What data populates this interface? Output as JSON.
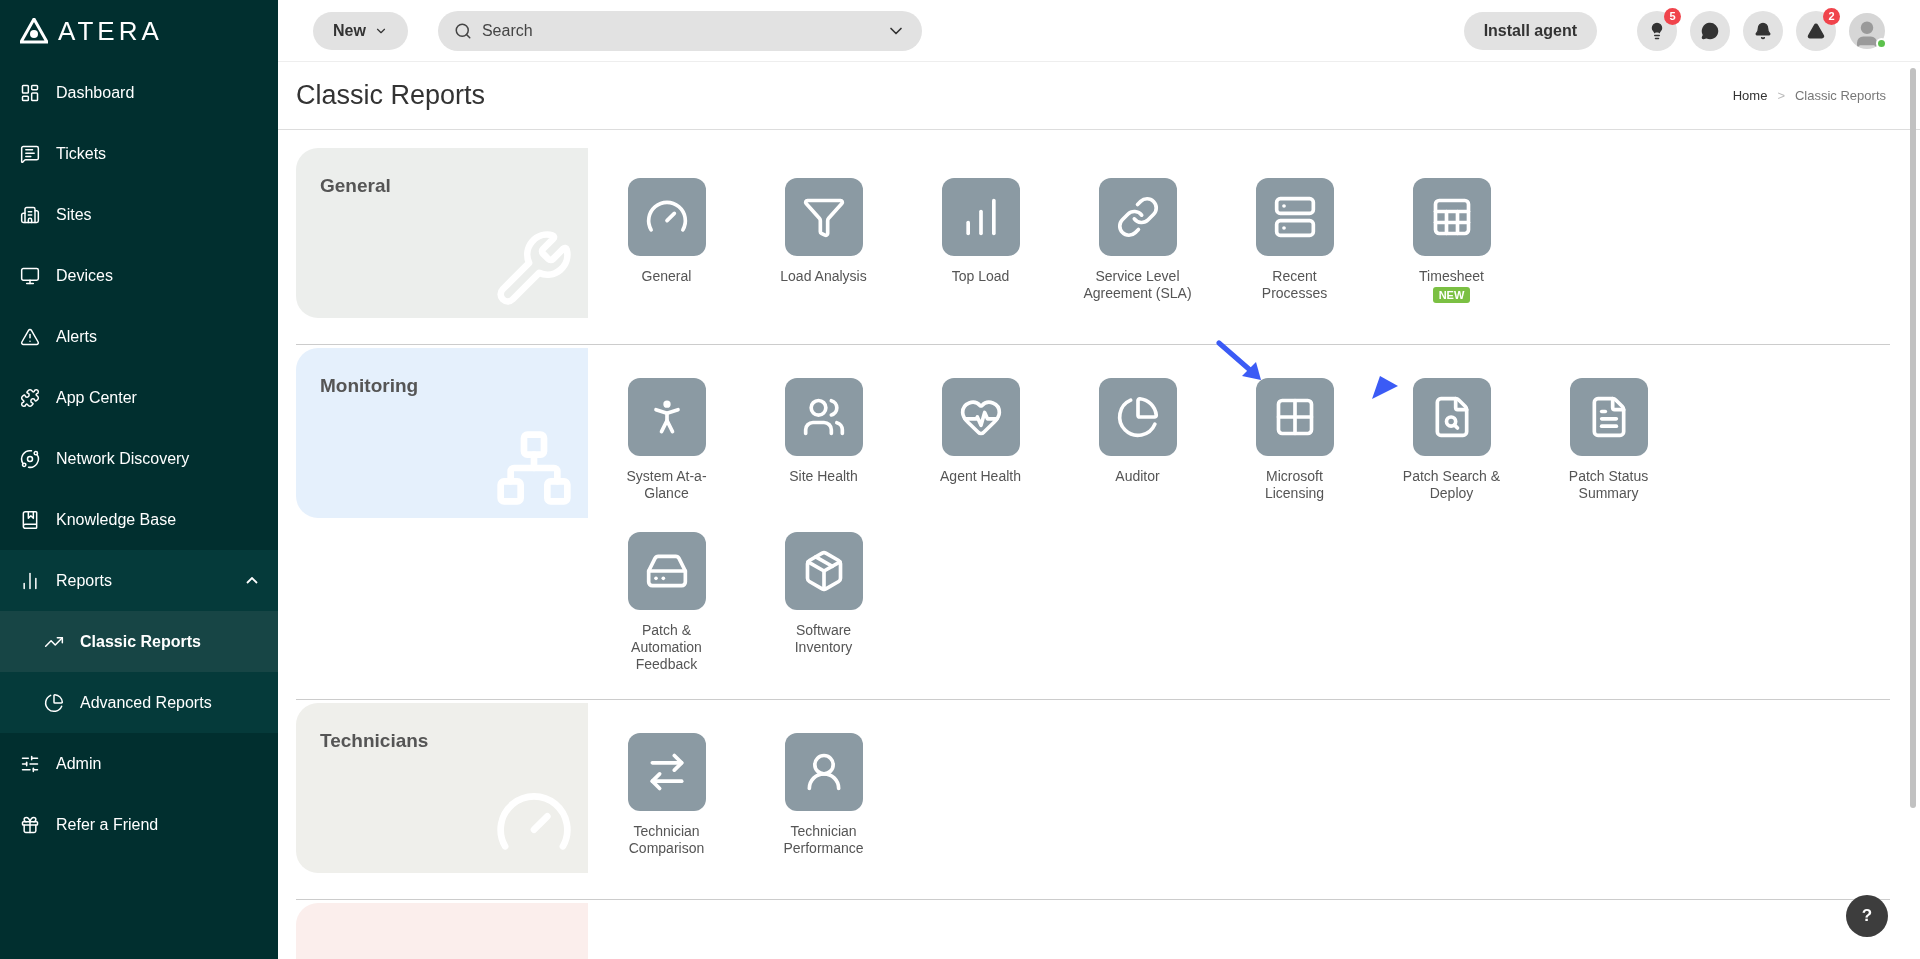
{
  "logo": "ATERA",
  "sidebar": {
    "items": [
      {
        "label": "Dashboard",
        "selected": false
      },
      {
        "label": "Tickets",
        "selected": false
      },
      {
        "label": "Sites",
        "selected": false
      },
      {
        "label": "Devices",
        "selected": false
      },
      {
        "label": "Alerts",
        "selected": false
      },
      {
        "label": "App Center",
        "selected": false
      },
      {
        "label": "Network Discovery",
        "selected": false
      },
      {
        "label": "Knowledge Base",
        "selected": false
      },
      {
        "label": "Reports",
        "selected": false,
        "expanded": true,
        "children": [
          {
            "label": "Classic Reports",
            "selected": true
          },
          {
            "label": "Advanced Reports",
            "selected": false
          }
        ]
      },
      {
        "label": "Admin",
        "selected": false
      },
      {
        "label": "Refer a Friend",
        "selected": false
      }
    ]
  },
  "topbar": {
    "new_button": "New",
    "search": {
      "placeholder": "Search"
    },
    "install_button": "Install agent",
    "badges": [
      {
        "kind": "tips",
        "count": "5"
      },
      {
        "kind": "chat"
      },
      {
        "kind": "notifications"
      },
      {
        "kind": "alerts",
        "count": "2"
      }
    ],
    "avatar_online": true
  },
  "page": {
    "title": "Classic Reports",
    "breadcrumb": [
      "Home",
      "Classic Reports"
    ],
    "breadcrumb_separator": ">"
  },
  "sections": [
    {
      "title": "General",
      "color": "#eceeec",
      "reports": [
        {
          "label": "General"
        },
        {
          "label": "Load Analysis"
        },
        {
          "label": "Top Load"
        },
        {
          "label": "Service Level Agreement (SLA)"
        },
        {
          "label": "Recent Processes"
        },
        {
          "label": "Timesheet",
          "badge": "NEW"
        }
      ]
    },
    {
      "title": "Monitoring",
      "color": "#e5f0fc",
      "reports": [
        {
          "label": "System At-a-Glance"
        },
        {
          "label": "Site Health"
        },
        {
          "label": "Agent Health"
        },
        {
          "label": "Auditor"
        },
        {
          "label": "Microsoft Licensing"
        },
        {
          "label": "Patch Search & Deploy"
        },
        {
          "label": "Patch Status Summary"
        },
        {
          "label": "Patch & Automation Feedback"
        },
        {
          "label": "Software Inventory"
        }
      ]
    },
    {
      "title": "Technicians",
      "color": "#efefeb",
      "reports": [
        {
          "label": "Technician Comparison"
        },
        {
          "label": "Technician Performance"
        }
      ]
    },
    {
      "color": "#fbeeec"
    }
  ],
  "help_button": "?"
}
